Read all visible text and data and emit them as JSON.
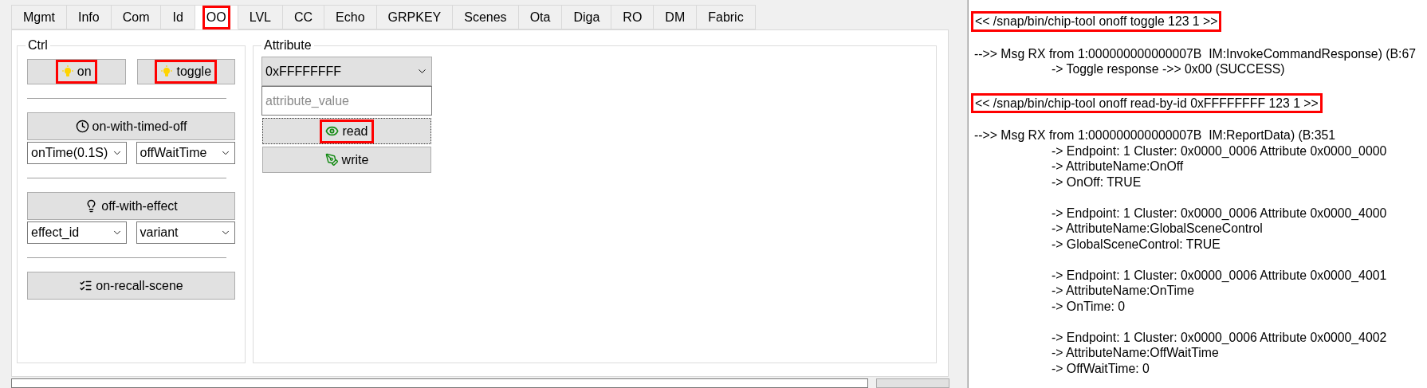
{
  "tabs": [
    {
      "label": "Mgmt",
      "selected": false,
      "highlighted": false
    },
    {
      "label": "Info",
      "selected": false,
      "highlighted": false
    },
    {
      "label": "Com",
      "selected": false,
      "highlighted": false
    },
    {
      "label": "Id",
      "selected": false,
      "highlighted": false
    },
    {
      "label": "OO",
      "selected": true,
      "highlighted": true
    },
    {
      "label": "LVL",
      "selected": false,
      "highlighted": false
    },
    {
      "label": "CC",
      "selected": false,
      "highlighted": false
    },
    {
      "label": "Echo",
      "selected": false,
      "highlighted": false
    },
    {
      "label": "GRPKEY",
      "selected": false,
      "highlighted": false
    },
    {
      "label": "Scenes",
      "selected": false,
      "highlighted": false
    },
    {
      "label": "Ota",
      "selected": false,
      "highlighted": false
    },
    {
      "label": "Diga",
      "selected": false,
      "highlighted": false
    },
    {
      "label": "RO",
      "selected": false,
      "highlighted": false
    },
    {
      "label": "DM",
      "selected": false,
      "highlighted": false
    },
    {
      "label": "Fabric",
      "selected": false,
      "highlighted": false
    }
  ],
  "ctrl": {
    "title": "Ctrl",
    "groups": [
      {
        "buttons": [
          {
            "label": "on",
            "highlighted": true
          },
          {
            "label": "toggle",
            "highlighted": true
          }
        ]
      },
      {
        "buttons": [
          {
            "label": "on-with-timed-off",
            "highlighted": false
          }
        ],
        "selects": [
          "onTime(0.1S)",
          "offWaitTime"
        ]
      },
      {
        "buttons": [
          {
            "label": "off-with-effect",
            "highlighted": false
          }
        ],
        "selects": [
          "effect_id",
          "variant"
        ]
      },
      {
        "buttons": [
          {
            "label": "on-recall-scene",
            "highlighted": false
          }
        ]
      }
    ]
  },
  "attribute": {
    "title": "Attribute",
    "select": "0xFFFFFFFF",
    "placeholder": "attribute_value",
    "buttons": [
      {
        "label": "read",
        "highlighted": true,
        "focused": true
      },
      {
        "label": "write",
        "highlighted": false,
        "focused": false
      }
    ]
  },
  "log": [
    {
      "kind": "command",
      "text": "<< /snap/bin/chip-tool onoff toggle 123 1 >>",
      "highlighted": true
    },
    {
      "kind": "message",
      "text": "-->> Msg RX from 1:000000000000007B  IM:InvokeCommandResponse) (B:67",
      "details": [
        [
          "-> Toggle response ->> 0x00 (SUCCESS)"
        ]
      ]
    },
    {
      "kind": "command",
      "text": "<< /snap/bin/chip-tool onoff read-by-id 0xFFFFFFFF 123 1 >>",
      "highlighted": true
    },
    {
      "kind": "message",
      "text": "-->> Msg RX from 1:000000000000007B  IM:ReportData) (B:351",
      "details": [
        [
          "-> Endpoint: 1 Cluster: 0x0000_0006 Attribute 0x0000_0000",
          "-> AttributeName:OnOff",
          "-> OnOff: TRUE"
        ],
        [
          "-> Endpoint: 1 Cluster: 0x0000_0006 Attribute 0x0000_4000",
          "-> AttributeName:GlobalSceneControl",
          "-> GlobalSceneControl: TRUE"
        ],
        [
          "-> Endpoint: 1 Cluster: 0x0000_0006 Attribute 0x0000_4001",
          "-> AttributeName:OnTime",
          "-> OnTime: 0"
        ],
        [
          "-> Endpoint: 1 Cluster: 0x0000_0006 Attribute 0x0000_4002",
          "-> AttributeName:OffWaitTime",
          "-> OffWaitTime: 0"
        ]
      ]
    }
  ]
}
